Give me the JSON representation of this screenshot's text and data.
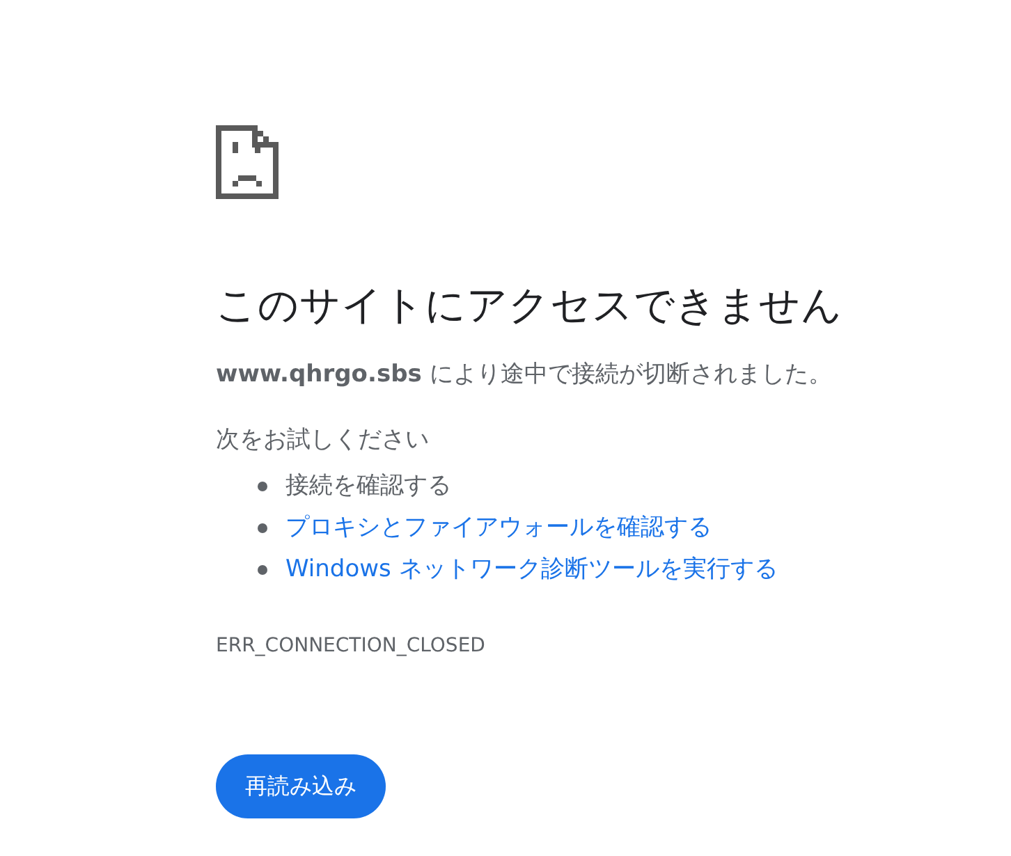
{
  "heading": "このサイトにアクセスできません",
  "message": "**www.qhrgo.sbs** により途中で接続が切断されました。",
  "suggestions": {
    "title": "次をお試しください",
    "items": [
      {
        "label": "接続を確認する",
        "kind": "text"
      },
      {
        "label": "プロキシとファイアウォールを確認する",
        "kind": "link"
      },
      {
        "label": "Windows ネットワーク診断ツールを実行する",
        "kind": "link"
      }
    ]
  },
  "error_code": "ERR_CONNECTION_CLOSED",
  "reload_button": {
    "label": "再読み込み"
  }
}
